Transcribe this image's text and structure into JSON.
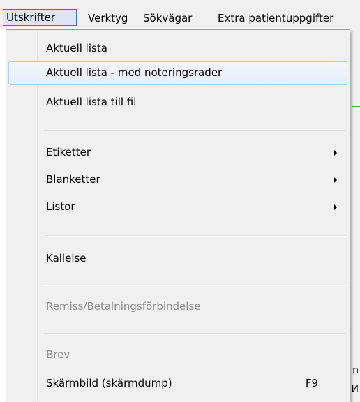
{
  "menubar": {
    "items": [
      {
        "label": "Utskrifter"
      },
      {
        "label": "Verktyg"
      },
      {
        "label": "Sökvägar"
      },
      {
        "label": "Extra patientuppgifter"
      }
    ]
  },
  "menu": {
    "items": [
      {
        "label": "Aktuell lista"
      },
      {
        "label": "Aktuell lista - med noteringsrader"
      },
      {
        "label": "Aktuell lista till fil"
      },
      {
        "label": "Etiketter"
      },
      {
        "label": "Blanketter"
      },
      {
        "label": "Listor"
      },
      {
        "label": "Kallelse"
      },
      {
        "label": "Remiss/Betalningsförbindelse"
      },
      {
        "label": "Brev"
      },
      {
        "label": "Skärmbild (skärmdump)",
        "shortcut": "F9"
      }
    ]
  },
  "background": {
    "edge_text_1": "n",
    "edge_text_2": "И"
  },
  "colors": {
    "hover_border": "#aecff7",
    "menubar_open_border": "#3b73b9",
    "disabled_text": "#8d8d8d"
  }
}
